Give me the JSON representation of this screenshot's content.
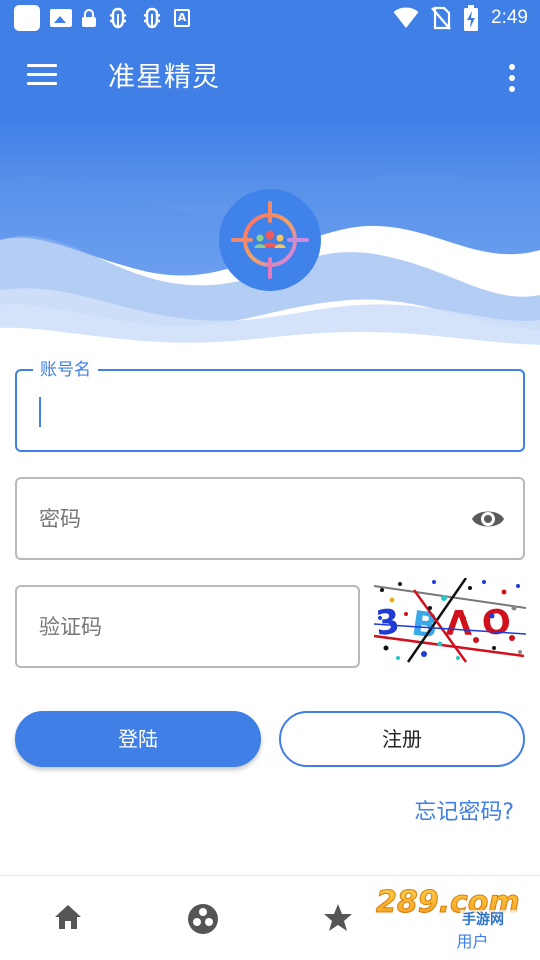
{
  "status_bar": {
    "time": "2:49",
    "icons_left": [
      "app-square-icon",
      "image-icon",
      "lock-icon",
      "bug-icon",
      "bug-icon",
      "a-badge-icon"
    ],
    "icons_right": [
      "wifi-icon",
      "no-sim-icon",
      "battery-charging-icon"
    ]
  },
  "app_bar": {
    "title": "准星精灵",
    "menu_icon": "hamburger-menu-icon",
    "more_icon": "more-vert-icon"
  },
  "hero": {
    "logo_icon": "crosshair-people-icon"
  },
  "form": {
    "username": {
      "label": "账号名",
      "value": ""
    },
    "password": {
      "placeholder": "密码",
      "toggle_icon": "eye-icon"
    },
    "captcha": {
      "placeholder": "验证码",
      "image_text": "3 B V O"
    }
  },
  "actions": {
    "login_label": "登陆",
    "register_label": "注册",
    "forgot_label": "忘记密码?"
  },
  "bottom_nav": {
    "items": [
      {
        "icon": "home-icon",
        "label": ""
      },
      {
        "icon": "community-icon",
        "label": ""
      },
      {
        "icon": "star-icon",
        "label": ""
      },
      {
        "icon": "user-icon",
        "label": "用户",
        "active": true
      }
    ]
  },
  "watermark": {
    "text": "289.com",
    "sub": "手游网"
  },
  "colors": {
    "primary": "#3f7fe6",
    "border": "#b9b9b9",
    "nav_icon": "#555555"
  }
}
